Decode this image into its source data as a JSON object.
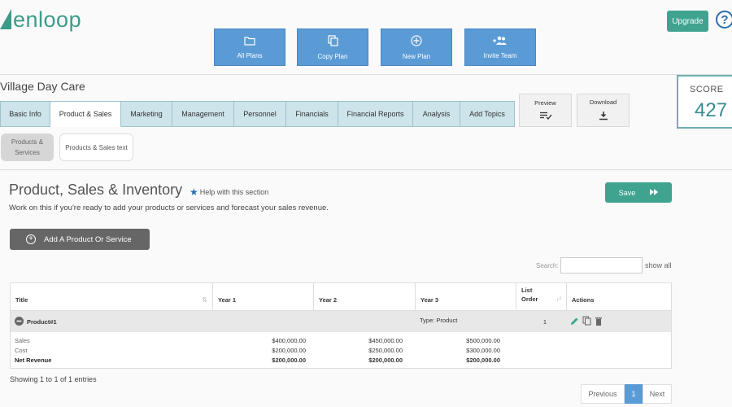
{
  "brand": {
    "logo_text": "enloop"
  },
  "header": {
    "upgrade_label": "Upgrade",
    "help_glyph": "?",
    "actions": [
      {
        "label": "All Plans",
        "icon": "folder-icon"
      },
      {
        "label": "Copy Plan",
        "icon": "copy-icon"
      },
      {
        "label": "New Plan",
        "icon": "plus-circle-icon"
      },
      {
        "label": "Invite Team",
        "icon": "add-users-icon"
      }
    ]
  },
  "plan": {
    "title": "Village Day Care"
  },
  "tabs": [
    "Basic Info",
    "Product & Sales",
    "Marketing",
    "Management",
    "Personnel",
    "Financials",
    "Financial Reports",
    "Analysis",
    "Add Topics"
  ],
  "active_tab": "Product & Sales",
  "preview_label": "Preview",
  "download_label": "Download",
  "score": {
    "label": "SCORE",
    "value": "427"
  },
  "subtabs": [
    {
      "label": "Products & Services",
      "active": true
    },
    {
      "label": "Products & Sales text",
      "active": false
    }
  ],
  "section": {
    "title": "Product, Sales & Inventory",
    "help_text": "Help with this section",
    "description": "Work on this if you're ready to add your products or services and forecast your sales revenue.",
    "save_label": "Save",
    "add_label": "Add A Product Or Service"
  },
  "search": {
    "label": "Search:",
    "value": "",
    "show_all": "show all"
  },
  "table": {
    "columns": [
      "Title",
      "Year 1",
      "Year 2",
      "Year 3",
      "List Order",
      "Actions"
    ],
    "product": {
      "name": "Product#1",
      "type": "Type: Product",
      "order": "1"
    },
    "rows": [
      {
        "label": "Sales",
        "y1": "$400,000.00",
        "y2": "$450,000.00",
        "y3": "$500,000.00"
      },
      {
        "label": "Cost",
        "y1": "$200,000.00",
        "y2": "$250,000.00",
        "y3": "$300,000.00"
      },
      {
        "label": "Net Revenue",
        "y1": "$200,000.00",
        "y2": "$200,000.00",
        "y3": "$200,000.00"
      }
    ]
  },
  "footer": {
    "showing": "Showing 1 to 1 of 1 entries",
    "previous": "Previous",
    "page": "1",
    "next": "Next"
  },
  "colors": {
    "accent_green": "#3fa390",
    "button_blue": "#5b9bd5",
    "tab_bg": "#cde4ea"
  }
}
